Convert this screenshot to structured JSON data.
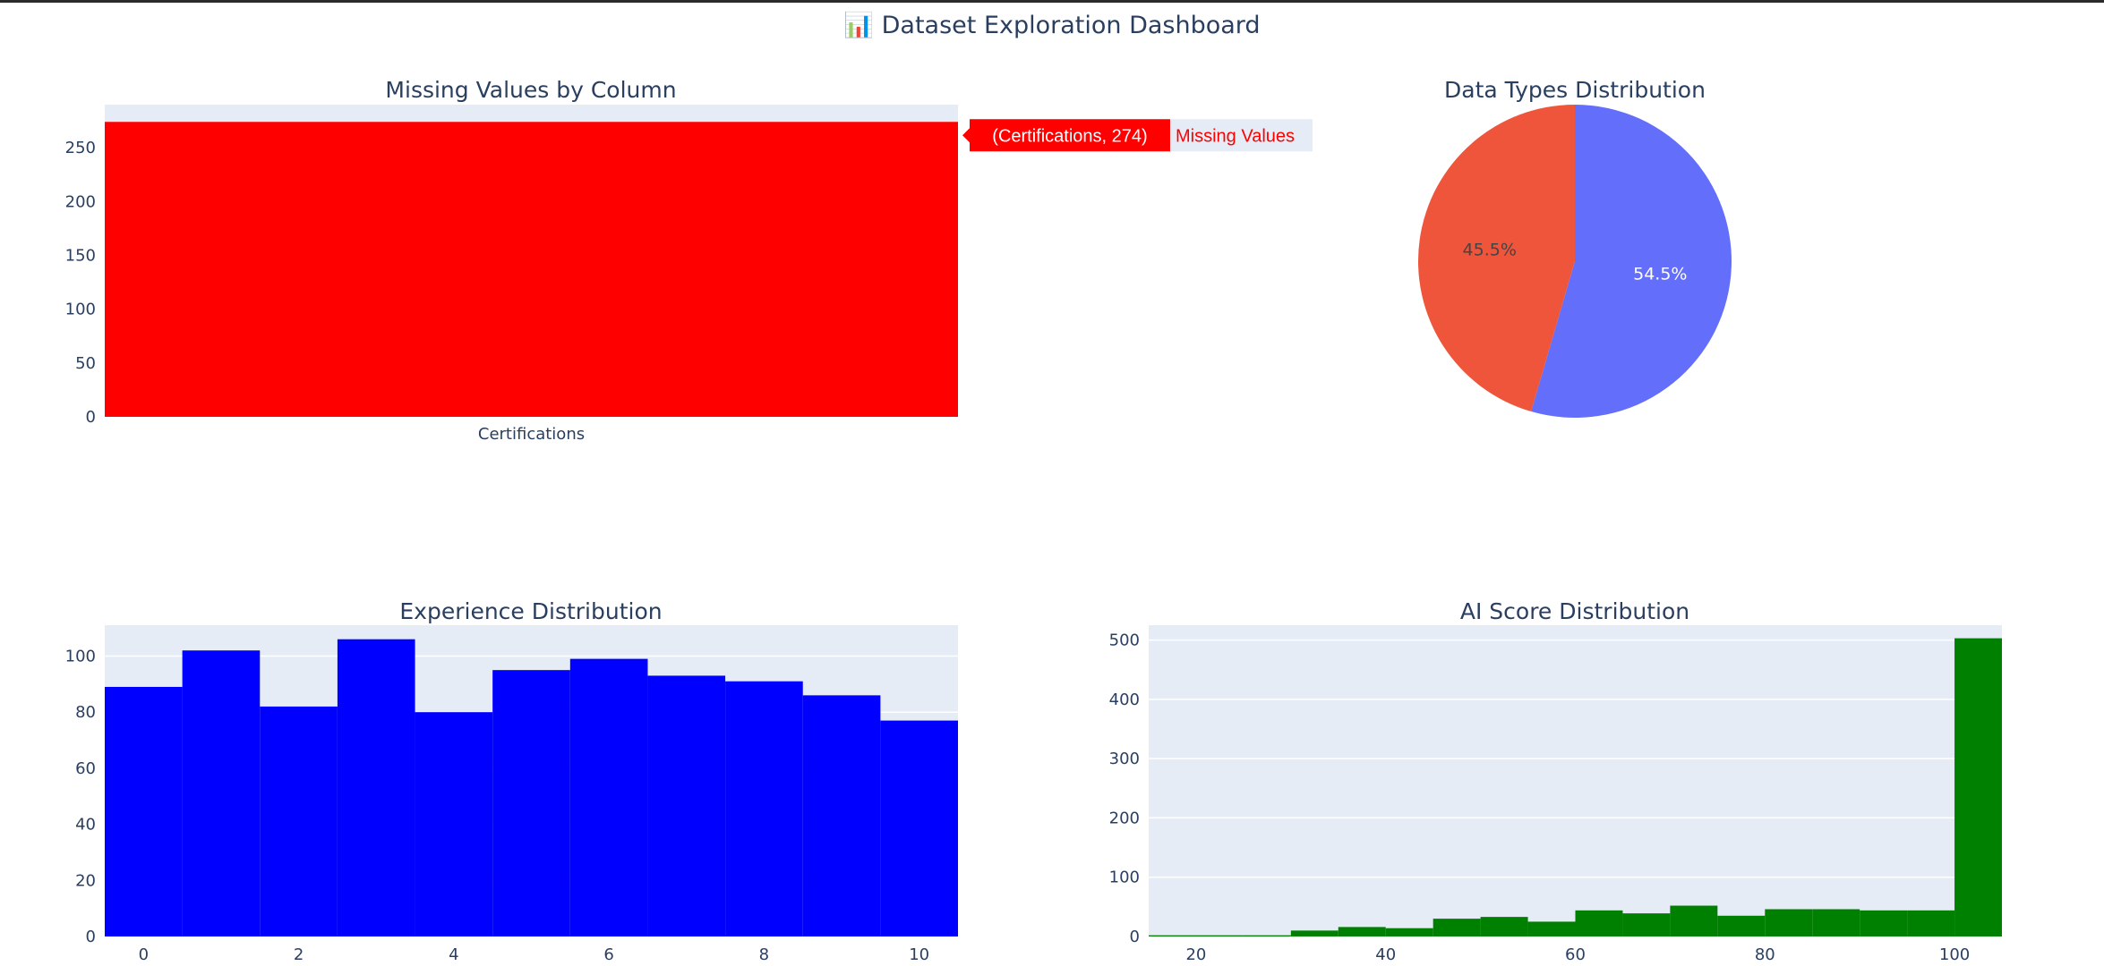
{
  "window": {
    "title": "📊 Dataset Exploration Dashboard"
  },
  "colors": {
    "plot_bg": "#e5ecf6",
    "grid": "#ffffff",
    "text": "#2a3f5f",
    "missing_bar": "#ff0000",
    "experience_bar": "#0000ff",
    "ai_score_bar": "#008000",
    "pie_1": "#636efa",
    "pie_2": "#ef553b"
  },
  "hover": {
    "point": "(Certifications, 274)",
    "series": "Missing Values"
  },
  "chart_data": [
    {
      "id": "missing",
      "type": "bar",
      "title": "Missing Values by Column",
      "categories": [
        "Certifications"
      ],
      "series": [
        {
          "name": "Missing Values",
          "values": [
            274
          ]
        }
      ],
      "ylim": [
        0,
        290
      ],
      "yticks": [
        0,
        50,
        100,
        150,
        200,
        250
      ],
      "grid": true
    },
    {
      "id": "dtypes",
      "type": "pie",
      "title": "Data Types Distribution",
      "slices": [
        {
          "value": 54.5,
          "label": "54.5%"
        },
        {
          "value": 45.5,
          "label": "45.5%"
        }
      ]
    },
    {
      "id": "experience",
      "type": "bar",
      "title": "Experience Distribution",
      "x": [
        0,
        1,
        2,
        3,
        4,
        5,
        6,
        7,
        8,
        9,
        10
      ],
      "values": [
        89,
        102,
        82,
        106,
        80,
        95,
        99,
        93,
        91,
        86,
        77
      ],
      "xlim": [
        -0.5,
        10.5
      ],
      "xticks": [
        0,
        2,
        4,
        6,
        8,
        10
      ],
      "ylim": [
        0,
        111
      ],
      "yticks": [
        0,
        20,
        40,
        60,
        80,
        100
      ],
      "grid": true
    },
    {
      "id": "aiscore",
      "type": "bar",
      "title": "AI Score Distribution",
      "bin_width": 5,
      "bin_starts": [
        15,
        20,
        25,
        30,
        35,
        40,
        45,
        50,
        55,
        60,
        65,
        70,
        75,
        80,
        85,
        90,
        95,
        100
      ],
      "values": [
        2,
        2,
        2,
        10,
        16,
        14,
        30,
        33,
        25,
        44,
        39,
        52,
        35,
        46,
        46,
        44,
        44,
        503
      ],
      "xlim": [
        15,
        105
      ],
      "xticks": [
        20,
        40,
        60,
        80,
        100
      ],
      "ylim": [
        0,
        525
      ],
      "yticks": [
        0,
        100,
        200,
        300,
        400,
        500
      ],
      "grid": true
    }
  ]
}
